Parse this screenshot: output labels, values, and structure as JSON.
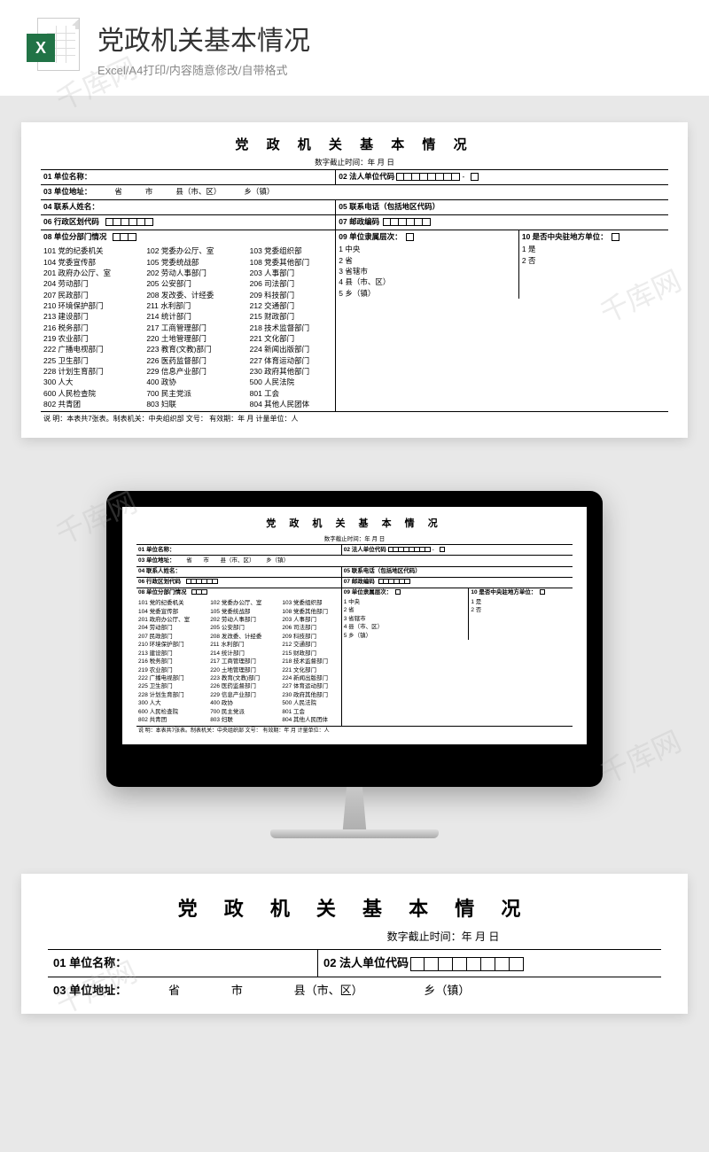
{
  "watermark_text": "千库网",
  "header": {
    "title": "党政机关基本情况",
    "subtitle": "Excel/A4打印/内容随意修改/自带格式",
    "icon_letter": "X"
  },
  "doc": {
    "title": "党 政 机 关 基 本 情 况",
    "subtitle": "数字截止时间：年 月 日",
    "f01": "01 单位名称：",
    "f02": "02 法人单位代码",
    "f03": "03 单位地址：",
    "f03_parts": {
      "province": "省",
      "city": "市",
      "county": "县（市、区）",
      "town": "乡（镇）"
    },
    "f04": "04 联系人姓名：",
    "f05": "05 联系电话（包括地区代码）",
    "f06": "06 行政区划代码",
    "f07": "07 邮政编码",
    "f08": "08 单位分部门情况",
    "f09": "09 单位隶属层次：",
    "f10": "10 是否中央驻地方单位：",
    "departments": [
      [
        "101 党的纪委机关",
        "102 党委办公厅、室",
        "103 党委组织部"
      ],
      [
        "104 党委宣传部",
        "105 党委统战部",
        "108 党委其他部门"
      ],
      [
        "201 政府办公厅、室",
        "202 劳动人事部门",
        "203 人事部门"
      ],
      [
        "204 劳动部门",
        "205 公安部门",
        "206 司法部门"
      ],
      [
        "207 民政部门",
        "208 发改委、计经委",
        "209 科技部门"
      ],
      [
        "210 环境保护部门",
        "211 水利部门",
        "212 交通部门"
      ],
      [
        "213 建设部门",
        "214 统计部门",
        "215 财政部门"
      ],
      [
        "216 税务部门",
        "217 工商管理部门",
        "218 技术监督部门"
      ],
      [
        "219 农业部门",
        "220 土地管理部门",
        "221 文化部门"
      ],
      [
        "222 广播电视部门",
        "223 教育(文教)部门",
        "224 新闻出版部门"
      ],
      [
        "225 卫生部门",
        "226 医药监督部门",
        "227 体育运动部门"
      ],
      [
        "228 计划生育部门",
        "229 信息产业部门",
        "230 政府其他部门"
      ],
      [
        "300 人大",
        "400 政协",
        "500 人民法院"
      ],
      [
        "600 人民检查院",
        "700 民主党派",
        "801 工会"
      ],
      [
        "802 共青团",
        "803 妇联",
        "804 其他人民团体"
      ]
    ],
    "levels": [
      "1 中央",
      "2 省",
      "3 省辖市",
      "4 县（市、区）",
      "5 乡（镇）"
    ],
    "yes_no": [
      "1   是",
      "2   否"
    ],
    "footer": "说   明：本表共7张表。制表机关：中央组织部     文号：          有效期：年 月     计量单位：人"
  }
}
